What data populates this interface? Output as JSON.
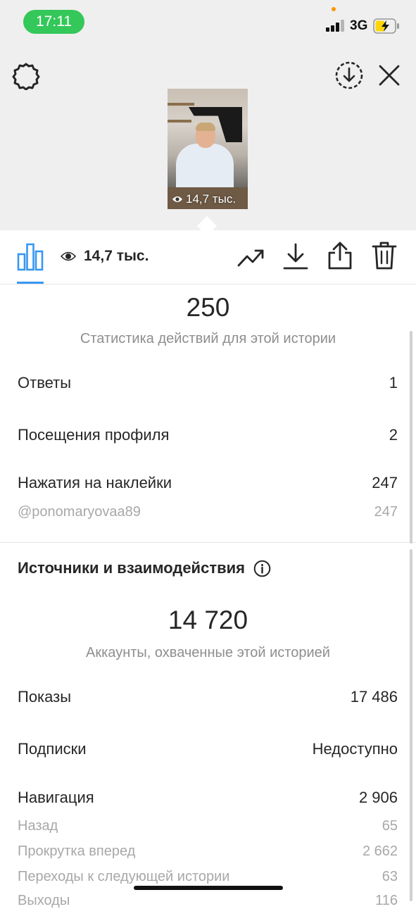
{
  "status_bar": {
    "time": "17:11",
    "network": "3G"
  },
  "story": {
    "views_overlay": "14,7 тыс."
  },
  "toolbar": {
    "views": "14,7 тыс."
  },
  "interactions": {
    "total": "250",
    "caption": "Статистика действий для этой истории",
    "rows": [
      {
        "label": "Ответы",
        "value": "1"
      },
      {
        "label": "Посещения профиля",
        "value": "2"
      },
      {
        "label": "Нажатия на наклейки",
        "value": "247"
      }
    ],
    "sticker_detail": {
      "label": "@ponomaryovaa89",
      "value": "247"
    }
  },
  "discovery": {
    "title": "Источники и взаимодействия",
    "total": "14 720",
    "caption": "Аккаунты, охваченные этой историей",
    "rows": [
      {
        "label": "Показы",
        "value": "17 486"
      },
      {
        "label": "Подписки",
        "value": "Недоступно"
      },
      {
        "label": "Навигация",
        "value": "2 906"
      }
    ],
    "navigation_details": [
      {
        "label": "Назад",
        "value": "65"
      },
      {
        "label": "Прокрутка вперед",
        "value": "2 662"
      },
      {
        "label": "Переходы к следующей истории",
        "value": "63"
      },
      {
        "label": "Выходы",
        "value": "116"
      }
    ]
  },
  "colors": {
    "accent": "#3897f0",
    "time_pill": "#34c759",
    "secondary_text": "#8e8e8e"
  },
  "icons": [
    "settings-icon",
    "download-circle-icon",
    "close-icon",
    "insights-icon",
    "eye-icon",
    "trend-icon",
    "download-icon",
    "share-icon",
    "trash-icon",
    "info-icon"
  ]
}
